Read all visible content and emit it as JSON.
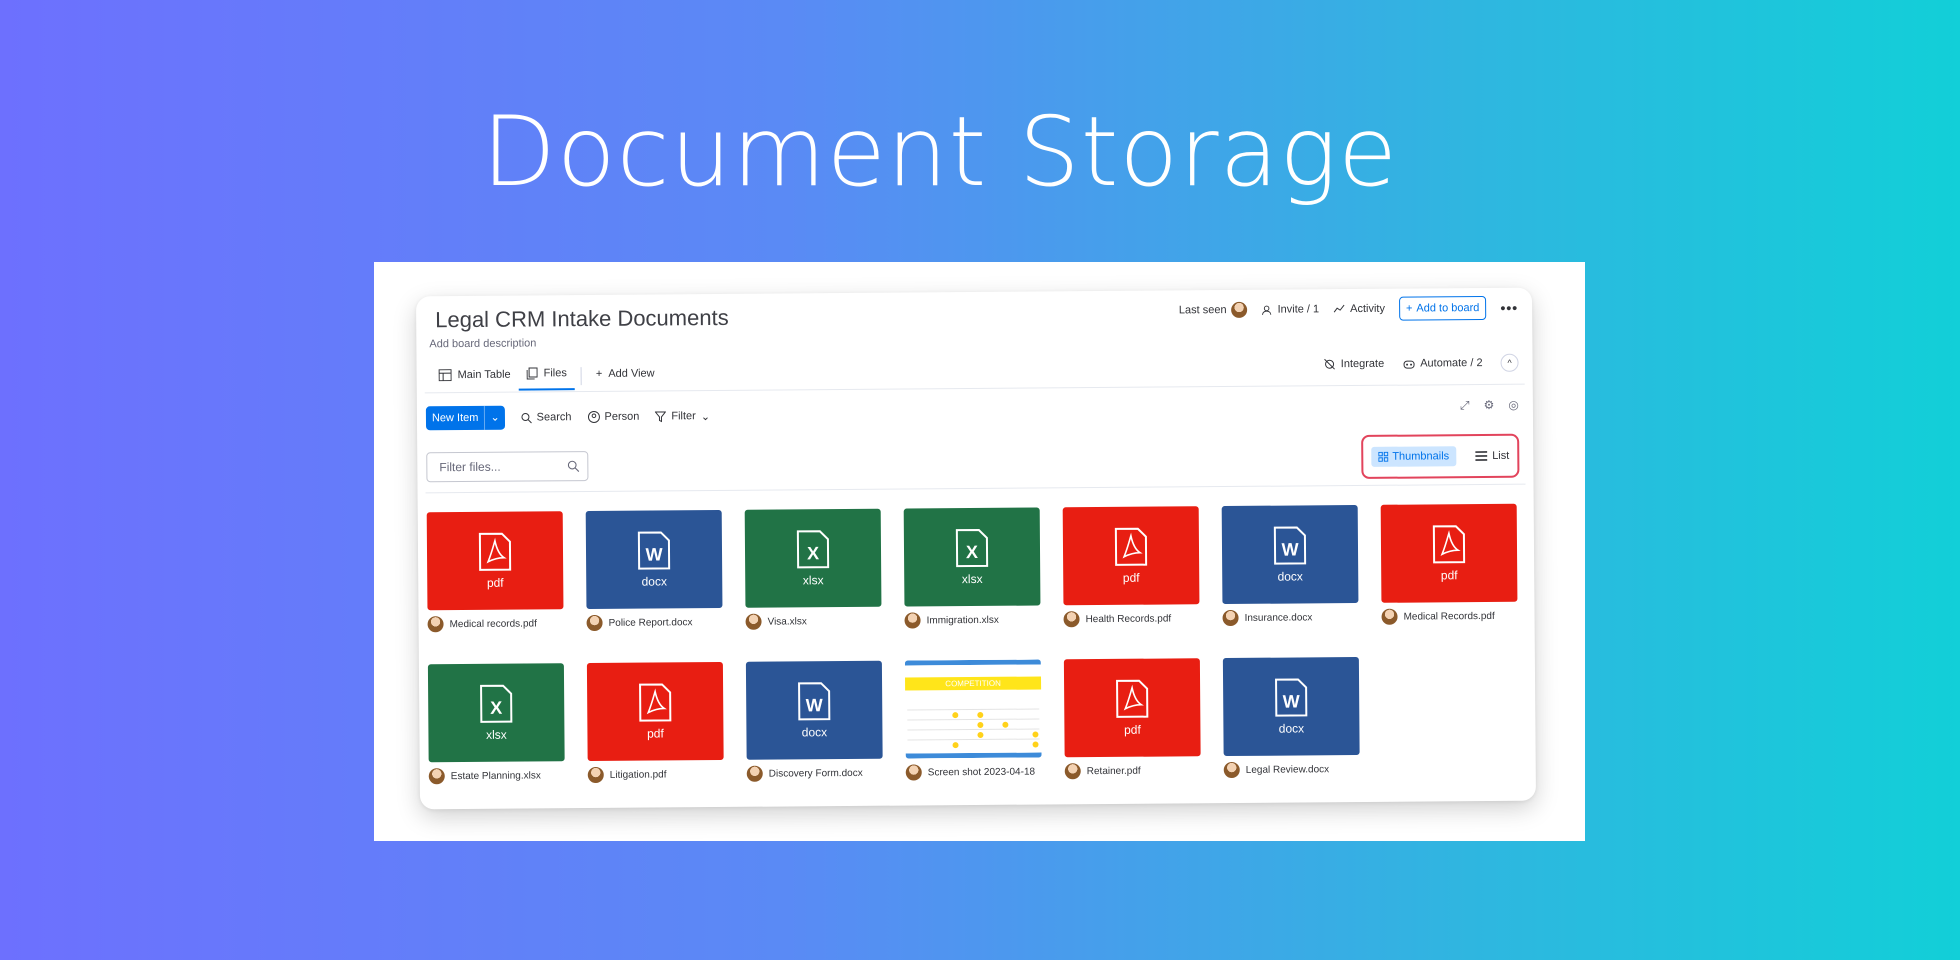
{
  "hero": {
    "title": "Document Storage"
  },
  "board": {
    "title": "Legal CRM Intake Documents",
    "description": "Add board description",
    "header": {
      "last_seen": "Last seen",
      "invite": "Invite / 1",
      "activity": "Activity",
      "add_to_board": "Add to board",
      "more": "•••"
    },
    "tabs": [
      {
        "label": "Main Table"
      },
      {
        "label": "Files"
      },
      {
        "label": "Add View"
      }
    ],
    "tabs_right": {
      "integrate": "Integrate",
      "automate": "Automate / 2"
    },
    "toolbar": {
      "new_item": "New Item",
      "search": "Search",
      "person": "Person",
      "filter": "Filter"
    },
    "filter_files": {
      "placeholder": "Filter files..."
    },
    "view_toggle": {
      "thumbnails": "Thumbnails",
      "list": "List"
    },
    "files": [
      {
        "name": "Medical records.pdf",
        "type": "pdf",
        "ext": "pdf"
      },
      {
        "name": "Police Report.docx",
        "type": "docx",
        "ext": "docx"
      },
      {
        "name": "Visa.xlsx",
        "type": "xlsx",
        "ext": "xlsx"
      },
      {
        "name": "Immigration.xlsx",
        "type": "xlsx",
        "ext": "xlsx"
      },
      {
        "name": "Health Records.pdf",
        "type": "pdf",
        "ext": "pdf"
      },
      {
        "name": "Insurance.docx",
        "type": "docx",
        "ext": "docx"
      },
      {
        "name": "Medical Records.pdf",
        "type": "pdf",
        "ext": "pdf"
      },
      {
        "name": "Estate Planning.xlsx",
        "type": "xlsx",
        "ext": "xlsx"
      },
      {
        "name": "Litigation.pdf",
        "type": "pdf",
        "ext": "pdf"
      },
      {
        "name": "Discovery Form.docx",
        "type": "docx",
        "ext": "docx"
      },
      {
        "name": "Screen shot 2023-04-18",
        "type": "image",
        "ext": ""
      },
      {
        "name": "Retainer.pdf",
        "type": "pdf",
        "ext": "pdf"
      },
      {
        "name": "Legal Review.docx",
        "type": "docx",
        "ext": "docx"
      }
    ],
    "screenshot_preview": {
      "banner": "COMPETITION"
    }
  },
  "colors": {
    "pdf": "#e81e12",
    "docx": "#2b5596",
    "xlsx": "#217346",
    "accent": "#0073ea",
    "highlight_border": "#e2445c"
  }
}
